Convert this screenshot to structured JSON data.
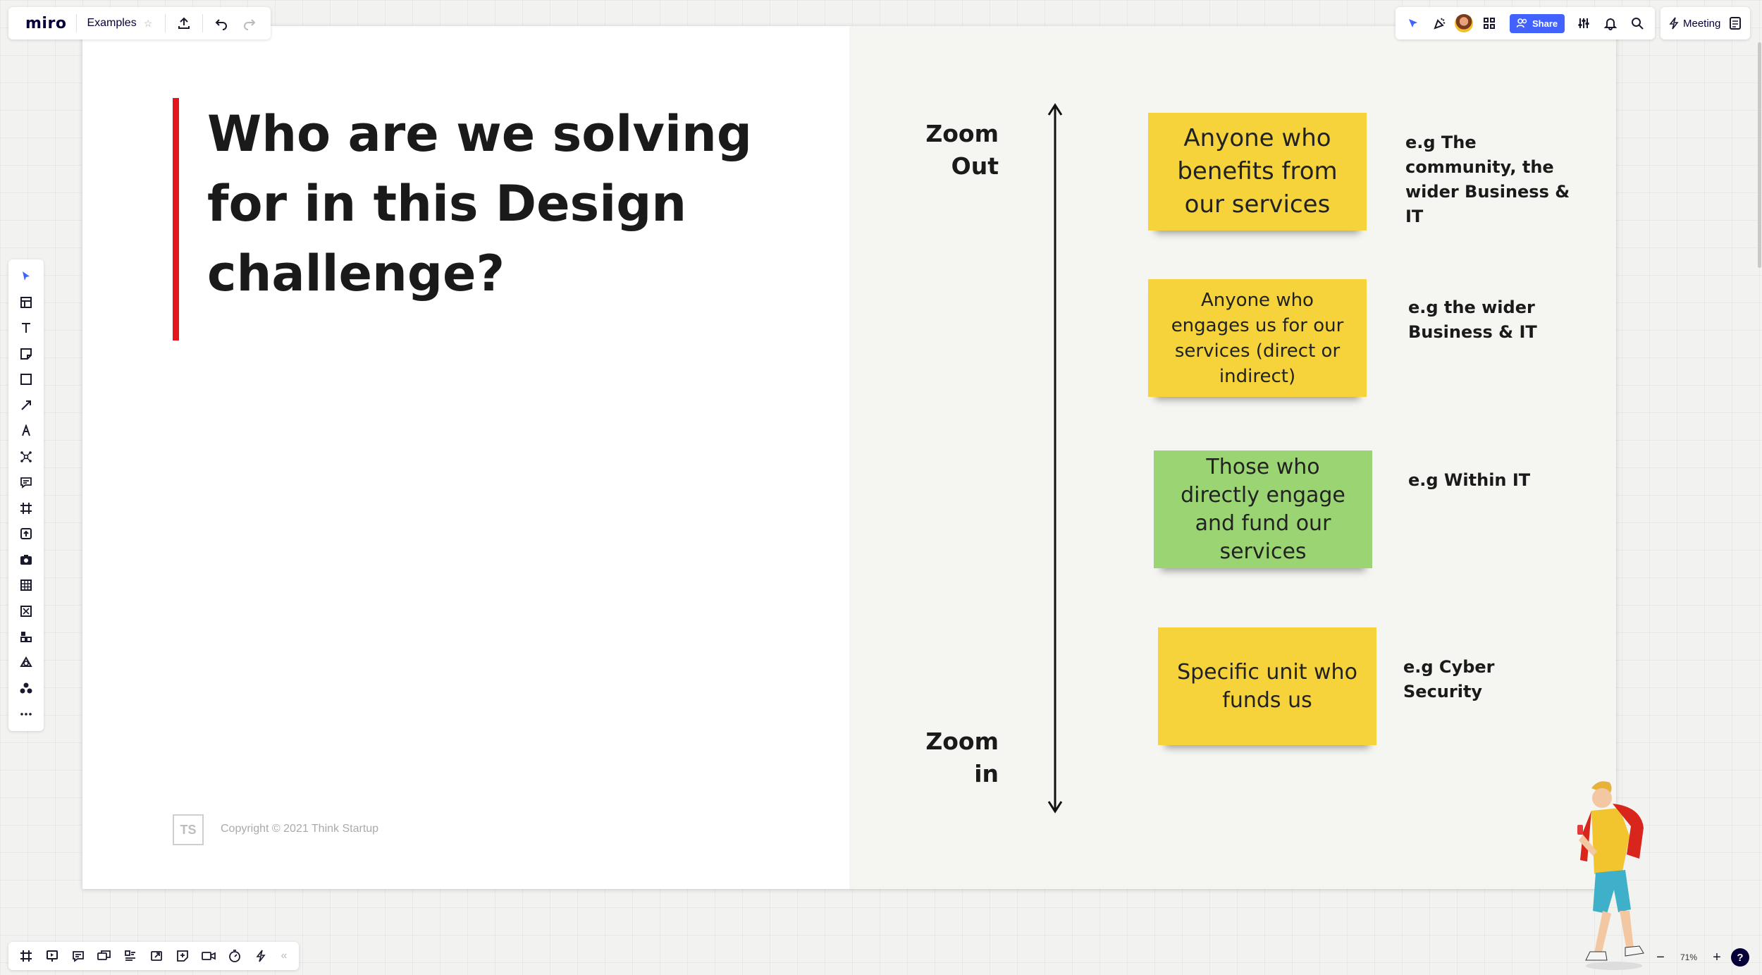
{
  "app": {
    "logo": "miro",
    "board_name": "Examples",
    "star_icon": "star-icon"
  },
  "top_left_toolbar": {
    "icons": [
      "upload-icon",
      "undo-icon",
      "redo-icon"
    ]
  },
  "top_right_toolbar": {
    "icons": [
      "cursor-follow-icon",
      "celebrate-icon",
      "avatar",
      "apps-grid-icon",
      "sliders-icon",
      "bell-icon",
      "search-icon"
    ],
    "share_label": "Share",
    "meeting_label": "Meeting",
    "notes_icon": "notes-icon"
  },
  "left_toolbar": {
    "tools": [
      "select-icon",
      "templates-icon",
      "text-icon",
      "sticky-note-icon",
      "shape-icon",
      "connection-line-icon",
      "pen-icon",
      "mind-map-icon",
      "comment-icon",
      "frame-icon",
      "upload-icon",
      "screenshot-icon",
      "table-icon",
      "embed-icon",
      "apps-icon",
      "integration-icon",
      "more-apps-icon",
      "more-icon"
    ]
  },
  "bottom_toolbar": {
    "tools": [
      "frames-icon",
      "presentation-icon",
      "comments-icon",
      "chat-icon",
      "cards-icon",
      "share-screen-icon",
      "sticky-capture-icon",
      "video-icon",
      "timer-icon",
      "activity-icon"
    ],
    "collapse_icon": "collapse-icon"
  },
  "zoom": {
    "value": "71%"
  },
  "slide": {
    "title": "Who are we solving for in this Design challenge?",
    "logo_text": "TS",
    "copyright": "Copyright © 2021 Think Startup",
    "zoom_out_label": "Zoom Out",
    "zoom_in_label": "Zoom in",
    "stickies": [
      {
        "text": "Anyone who benefits from our services",
        "color": "#f6d33a",
        "example": "e.g The community, the wider Business & IT"
      },
      {
        "text": "Anyone who engages us for our services (direct or indirect)",
        "color": "#f6d33a",
        "example": "e.g the wider Business & IT"
      },
      {
        "text": "Those who directly engage and fund our services",
        "color": "#9bd573",
        "example": "e.g Within IT"
      },
      {
        "text": "Specific unit who funds us",
        "color": "#f6d33a",
        "example": "e.g Cyber Security"
      }
    ]
  },
  "colors": {
    "accent_blue": "#4262ff",
    "title_bar_red": "#e5151d",
    "sticky_yellow": "#f6d33a",
    "sticky_green": "#9bd573"
  }
}
